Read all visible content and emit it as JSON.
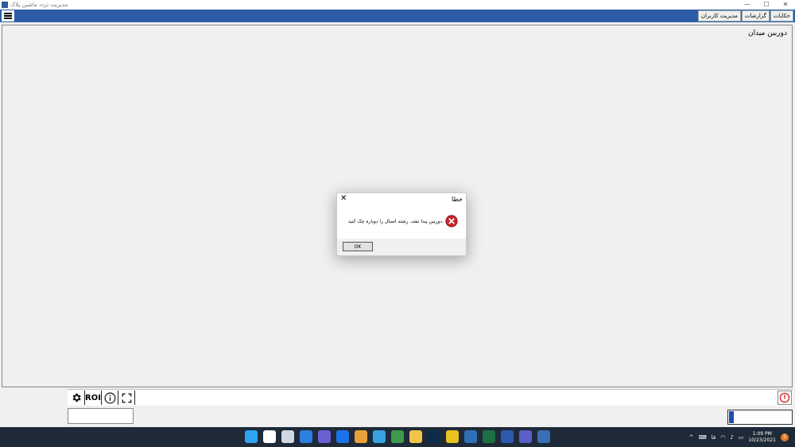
{
  "window": {
    "title": "مدیریت تردد ماشین پلاک",
    "min": "—",
    "max": "☐",
    "close": "✕"
  },
  "menu": {
    "tabs": [
      "حکایات",
      "گزارشات",
      "مدیریت کاربران"
    ]
  },
  "camera": {
    "label": "دوربین میدان"
  },
  "toolbar": {
    "roi": "ROI"
  },
  "dialog": {
    "title": "خطا",
    "message": "دوربین پیدا نشد. رشته اتصال را دوباره چک کنید.",
    "ok": "OK",
    "close": "✕"
  },
  "taskbar": {
    "time": "1:09 PM",
    "date": "10/23/2021",
    "lang": "فا",
    "notifications": "5",
    "icons": [
      {
        "name": "windows-start-icon",
        "color": "#2ea3f2"
      },
      {
        "name": "search-icon",
        "color": "#ffffff"
      },
      {
        "name": "task-view-icon",
        "color": "#cfd8e3"
      },
      {
        "name": "widgets-icon",
        "color": "#2d7fe0"
      },
      {
        "name": "chat-icon",
        "color": "#6b5fd4"
      },
      {
        "name": "mail-icon",
        "color": "#1a73e8"
      },
      {
        "name": "chrome-icon",
        "color": "#e8a13a"
      },
      {
        "name": "edge-icon",
        "color": "#36a3e0"
      },
      {
        "name": "browser-icon",
        "color": "#3c9b4b"
      },
      {
        "name": "file-explorer-icon",
        "color": "#f2c44b"
      },
      {
        "name": "photoshop-icon",
        "color": "#0b2d4a"
      },
      {
        "name": "sticky-notes-icon",
        "color": "#e8c31f"
      },
      {
        "name": "app-icon",
        "color": "#2f6fb6"
      },
      {
        "name": "excel-icon",
        "color": "#1d7044"
      },
      {
        "name": "word-icon",
        "color": "#2b5bb0"
      },
      {
        "name": "teams-icon",
        "color": "#5b5fc7"
      },
      {
        "name": "plate-app-icon",
        "color": "#3a6fb5"
      }
    ]
  }
}
